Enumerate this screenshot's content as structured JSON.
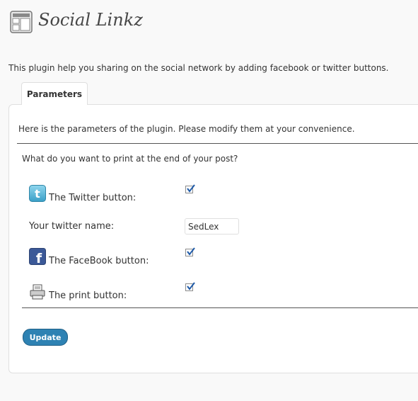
{
  "page": {
    "title": "Social Linkz",
    "intro": "This plugin help you sharing on the social network by adding facebook or twitter buttons."
  },
  "tabs": [
    {
      "label": "Parameters",
      "active": true
    }
  ],
  "panel": {
    "description": "Here is the parameters of the plugin. Please modify them at your convenience.",
    "question": "What do you want to print at the end of your post?"
  },
  "options": {
    "twitter": {
      "label": "The Twitter button:",
      "checked": true,
      "icon": "twitter-icon"
    },
    "twitter_name": {
      "label": "Your twitter name:",
      "value": "SedLex"
    },
    "facebook": {
      "label": "The FaceBook button:",
      "checked": true,
      "icon": "facebook-icon"
    },
    "print": {
      "label": "The print button:",
      "checked": true,
      "icon": "printer-icon"
    }
  },
  "actions": {
    "update_label": "Update"
  },
  "colors": {
    "button": "#2e82b3",
    "twitter": "#4fb4d8",
    "facebook": "#3b5998"
  }
}
